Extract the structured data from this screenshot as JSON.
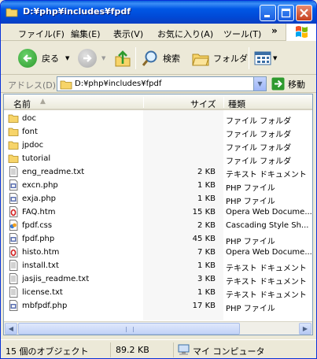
{
  "window": {
    "title": "D:¥php¥includes¥fpdf",
    "controls": {
      "minimize": "_",
      "maximize": "□",
      "close": "✕"
    }
  },
  "menubar": {
    "items": [
      "ファイル(F)",
      "編集(E)",
      "表示(V)",
      "お気に入り(A)",
      "ツール(T)"
    ],
    "chevron": "»"
  },
  "toolbar": {
    "back_label": "戻る",
    "search_label": "検索",
    "folders_label": "フォルダ"
  },
  "addressbar": {
    "label": "アドレス(D)",
    "value": "D:¥php¥includes¥fpdf",
    "go_label": "移動"
  },
  "list": {
    "columns": {
      "name": "名前",
      "size": "サイズ",
      "type": "種類"
    },
    "rows": [
      {
        "name": "doc",
        "size": "",
        "type": "ファイル フォルダ",
        "icon": "folder-icon"
      },
      {
        "name": "font",
        "size": "",
        "type": "ファイル フォルダ",
        "icon": "folder-icon"
      },
      {
        "name": "jpdoc",
        "size": "",
        "type": "ファイル フォルダ",
        "icon": "folder-icon"
      },
      {
        "name": "tutorial",
        "size": "",
        "type": "ファイル フォルダ",
        "icon": "folder-icon"
      },
      {
        "name": "eng_readme.txt",
        "size": "2 KB",
        "type": "テキスト ドキュメント",
        "icon": "text-file-icon"
      },
      {
        "name": "excn.php",
        "size": "1 KB",
        "type": "PHP ファイル",
        "icon": "php-file-icon"
      },
      {
        "name": "exja.php",
        "size": "1 KB",
        "type": "PHP ファイル",
        "icon": "php-file-icon"
      },
      {
        "name": "FAQ.htm",
        "size": "15 KB",
        "type": "Opera Web Docume...",
        "icon": "opera-html-icon"
      },
      {
        "name": "fpdf.css",
        "size": "2 KB",
        "type": "Cascading Style Sh...",
        "icon": "css-file-icon"
      },
      {
        "name": "fpdf.php",
        "size": "45 KB",
        "type": "PHP ファイル",
        "icon": "php-file-icon"
      },
      {
        "name": "histo.htm",
        "size": "7 KB",
        "type": "Opera Web Docume...",
        "icon": "opera-html-icon"
      },
      {
        "name": "install.txt",
        "size": "1 KB",
        "type": "テキスト ドキュメント",
        "icon": "text-file-icon"
      },
      {
        "name": "jasjis_readme.txt",
        "size": "3 KB",
        "type": "テキスト ドキュメント",
        "icon": "text-file-icon"
      },
      {
        "name": "license.txt",
        "size": "1 KB",
        "type": "テキスト ドキュメント",
        "icon": "text-file-icon"
      },
      {
        "name": "mbfpdf.php",
        "size": "17 KB",
        "type": "PHP ファイル",
        "icon": "php-file-icon"
      }
    ]
  },
  "statusbar": {
    "objects": "15 個のオブジェクト",
    "total_size": "89.2 KB",
    "location": "マイ コンピュータ"
  },
  "colors": {
    "titlebar": "#0058e6",
    "folder": "#f7d469",
    "back_arrow": "#2e9a2e",
    "go_arrow": "#2e9a2e"
  }
}
